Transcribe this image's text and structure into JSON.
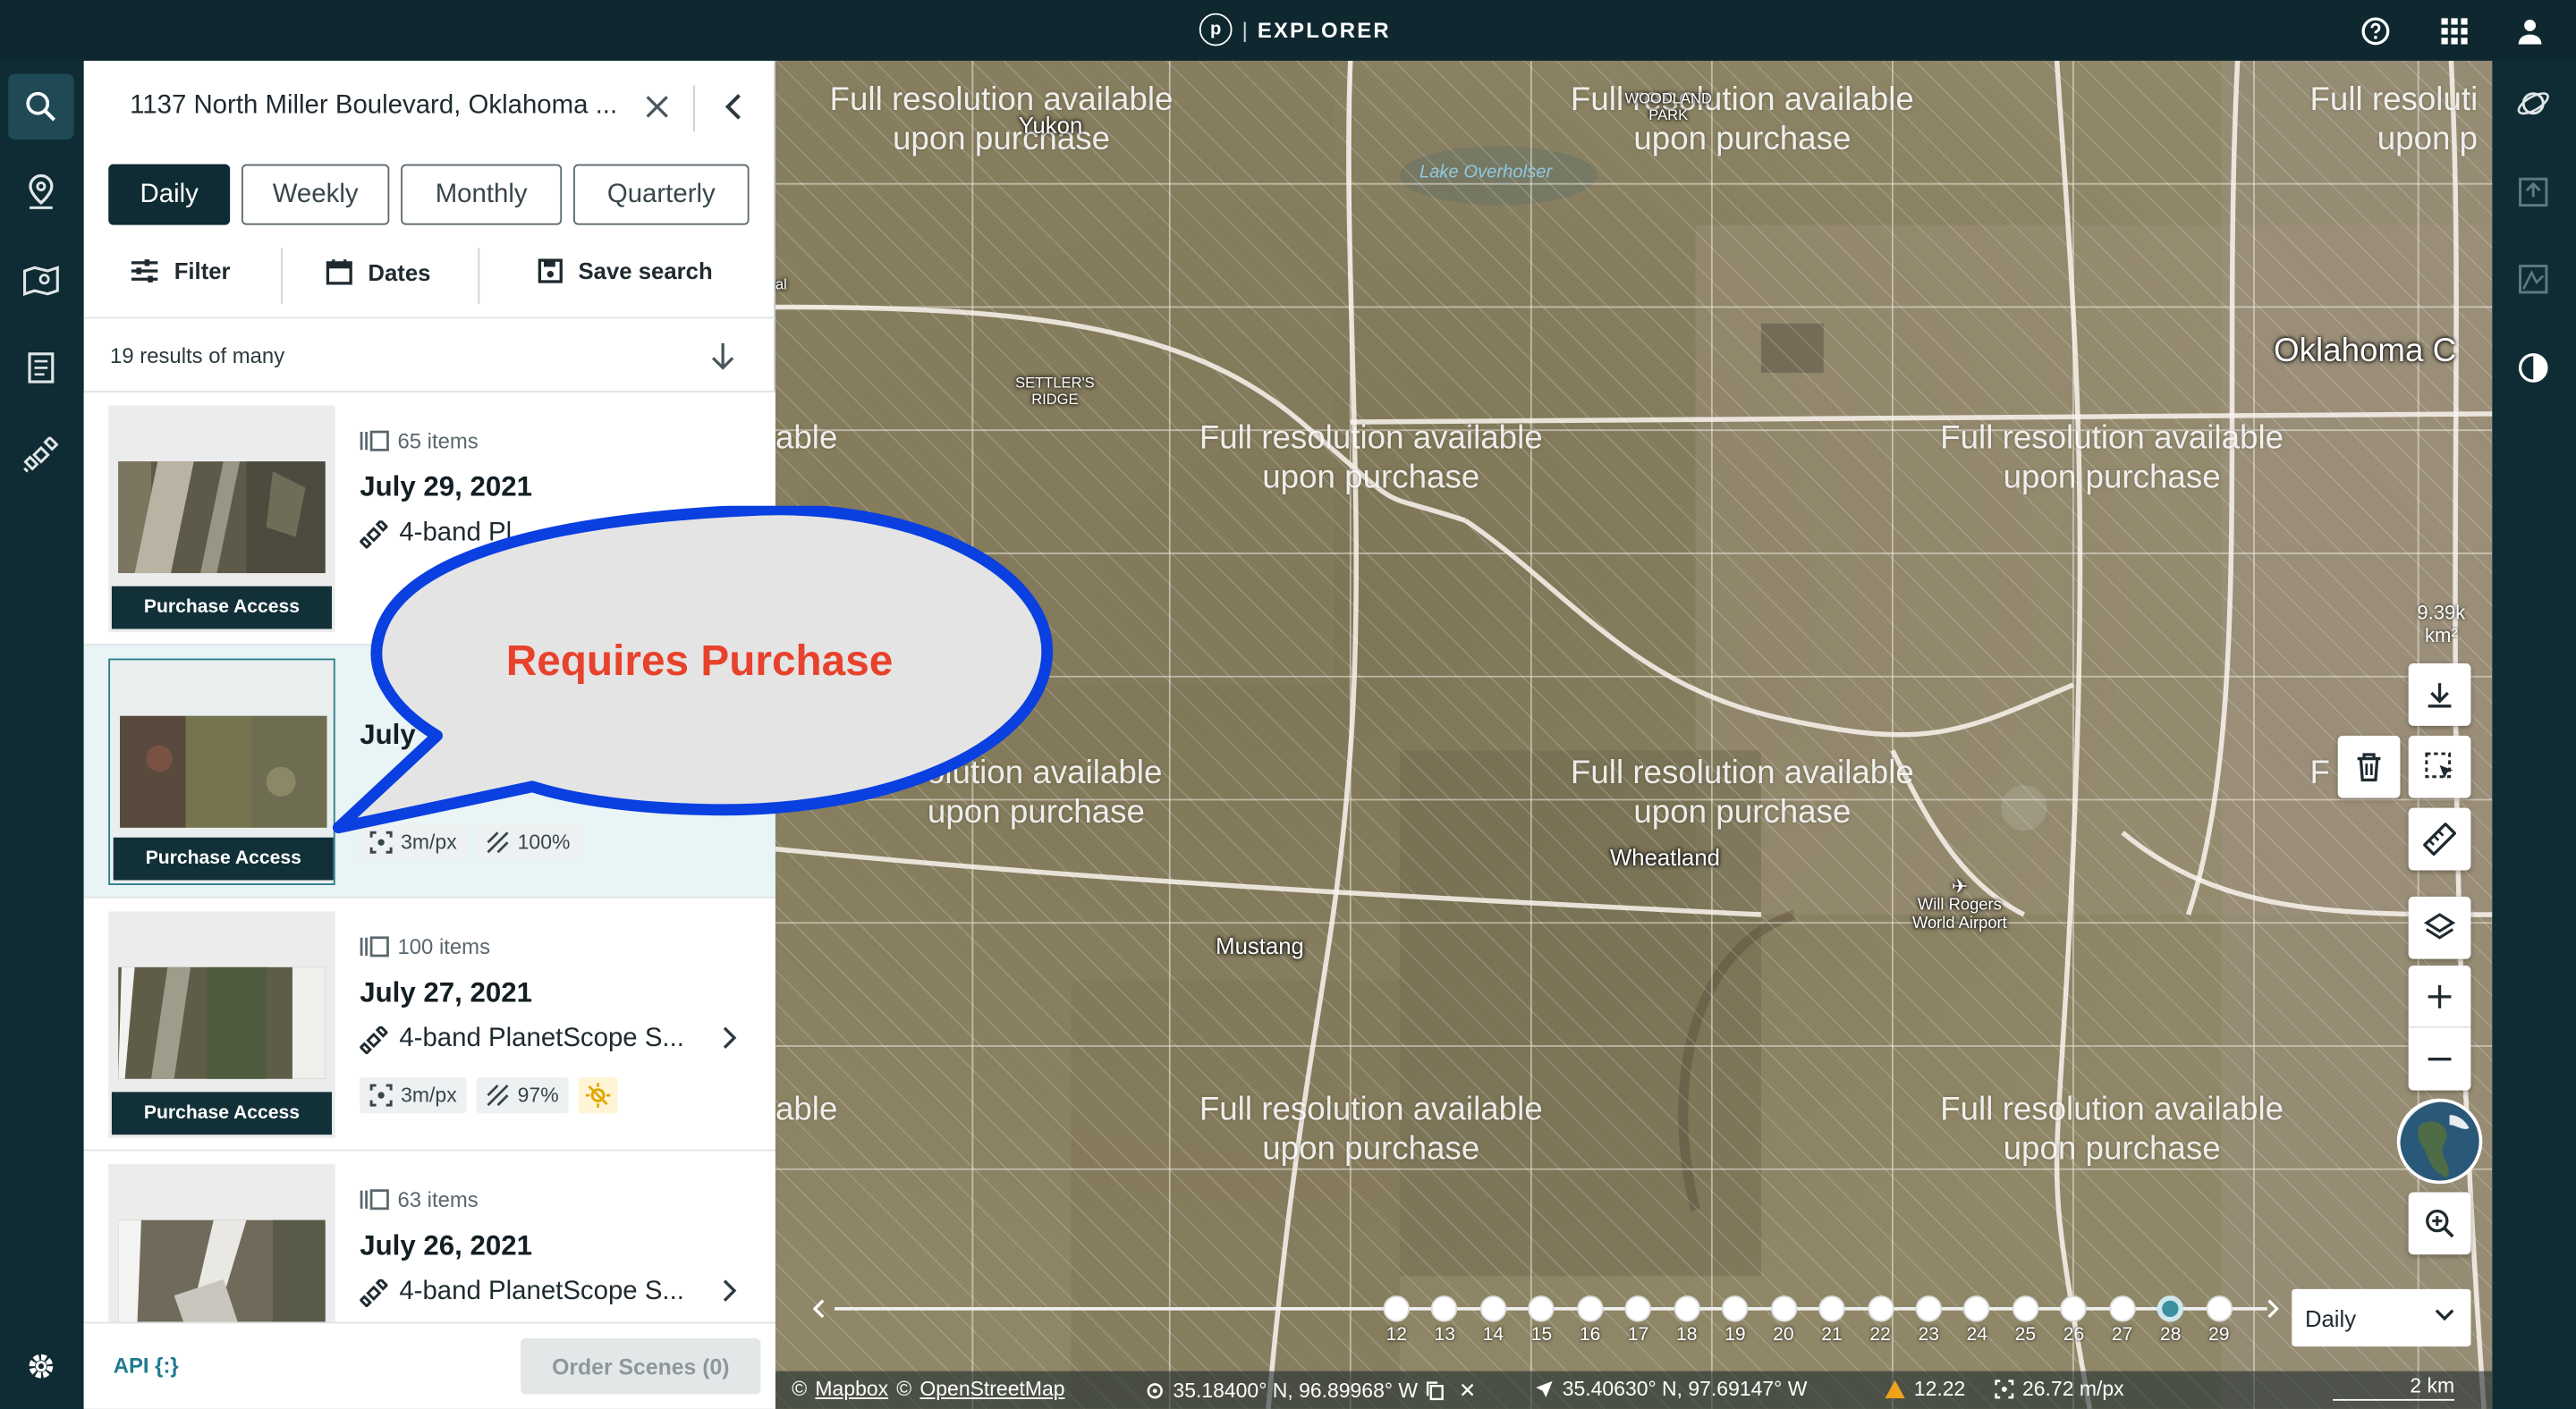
{
  "header": {
    "logo_letter": "p",
    "separator": "|",
    "app_name": "EXPLORER"
  },
  "left_rail": {
    "icons": [
      "search-icon",
      "location-pin-icon",
      "saved-map-icon",
      "notebook-icon",
      "satellite-icon",
      "settings-icon"
    ]
  },
  "right_rail": {
    "icons": [
      "globe-orbit-icon",
      "export-icon",
      "terrain-icon",
      "contrast-icon"
    ]
  },
  "search": {
    "value": "1137 North Miller Boulevard, Oklahoma ..."
  },
  "tabs": [
    {
      "label": "Daily",
      "active": true
    },
    {
      "label": "Weekly",
      "active": false
    },
    {
      "label": "Monthly",
      "active": false
    },
    {
      "label": "Quarterly",
      "active": false
    }
  ],
  "actions": {
    "filter": "Filter",
    "dates": "Dates",
    "save_search": "Save search"
  },
  "results": {
    "summary": "19 results of many"
  },
  "items": [
    {
      "count": "65 items",
      "date": "July 29, 2021",
      "product": "4-band Pl",
      "purchase": "Purchase Access",
      "badges": []
    },
    {
      "count": "",
      "date": "July",
      "product": "",
      "purchase": "Purchase Access",
      "badges": [
        "3m/px",
        "100%"
      ]
    },
    {
      "count": "100 items",
      "date": "July 27, 2021",
      "product": "4-band PlanetScope S...",
      "purchase": "Purchase Access",
      "badges": [
        "3m/px",
        "97%"
      ]
    },
    {
      "count": "63 items",
      "date": "July 26, 2021",
      "product": "4-band PlanetScope S...",
      "purchase": "",
      "badges": []
    }
  ],
  "footer": {
    "api": "API {:}",
    "order": "Order Scenes (0)"
  },
  "map": {
    "overlay_lines": [
      "Full resolution available",
      "upon purchase"
    ],
    "partial_overlay": [
      "Full resoluti",
      "upon p"
    ],
    "partial_left": [
      "able"
    ],
    "partial_left2": [
      "solution available",
      "upon purchase"
    ],
    "partial_left3": [
      "F"
    ],
    "places": {
      "yukon": "Yukon",
      "woodland": "WOODLAND",
      "park": "PARK",
      "lake": "Lake Overholser",
      "settlers": "SETTLER'S",
      "ridge": "RIDGE",
      "okc": "Oklahoma C",
      "wheatland": "Wheatland",
      "mustang": "Mustang",
      "airport1": "Will Rogers",
      "airport2": "World Airport",
      "bethany_frag": "al"
    },
    "area": {
      "value": "9.39k",
      "unit": "km²"
    },
    "timeline": {
      "labels": [
        "12",
        "13",
        "14",
        "15",
        "16",
        "17",
        "18",
        "19",
        "20",
        "21",
        "22",
        "23",
        "24",
        "25",
        "26",
        "27",
        "28",
        "29"
      ],
      "active": "28"
    },
    "interval": "Daily",
    "status": {
      "mapbox": "Mapbox",
      "osm": "OpenStreetMap",
      "cursor": "35.18400° N, 96.89968° W",
      "center": "35.40630° N, 97.69147° W",
      "warning": "12.22",
      "resolution": "26.72 m/px",
      "scale": "2 km"
    }
  },
  "callout": {
    "text": "Requires Purchase"
  },
  "colors": {
    "accent": "#1e7a8f",
    "dark": "#0f2b33",
    "callout_border": "#0a3fe0",
    "callout_text": "#e8412c"
  }
}
